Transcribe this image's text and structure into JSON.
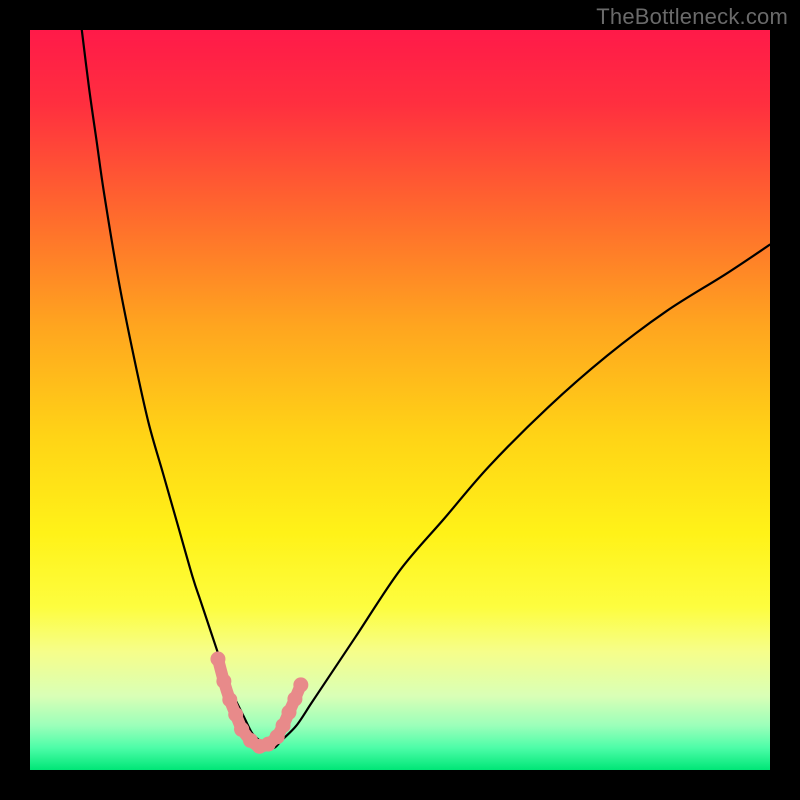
{
  "watermark": "TheBottleneck.com",
  "chart_data": {
    "type": "line",
    "title": "",
    "xlabel": "",
    "ylabel": "",
    "xlim": [
      0,
      100
    ],
    "ylim": [
      0,
      100
    ],
    "grid": false,
    "legend": false,
    "annotations": [],
    "background_gradient": {
      "type": "vertical",
      "stops": [
        {
          "offset": 0.0,
          "color": "#ff1a49"
        },
        {
          "offset": 0.1,
          "color": "#ff2f3f"
        },
        {
          "offset": 0.25,
          "color": "#ff6a2d"
        },
        {
          "offset": 0.4,
          "color": "#ffa51f"
        },
        {
          "offset": 0.55,
          "color": "#ffd416"
        },
        {
          "offset": 0.68,
          "color": "#fff218"
        },
        {
          "offset": 0.78,
          "color": "#fdfd3f"
        },
        {
          "offset": 0.84,
          "color": "#f6fe8a"
        },
        {
          "offset": 0.9,
          "color": "#d9ffb6"
        },
        {
          "offset": 0.94,
          "color": "#9bffba"
        },
        {
          "offset": 0.97,
          "color": "#4dfda8"
        },
        {
          "offset": 1.0,
          "color": "#00e677"
        }
      ]
    },
    "series": [
      {
        "name": "bottleneck-curve",
        "color": "#000000",
        "x": [
          7,
          8,
          9,
          10,
          12,
          14,
          16,
          18,
          20,
          22,
          23,
          24,
          25,
          26,
          27,
          28,
          29,
          30,
          31,
          32,
          33,
          34,
          36,
          38,
          40,
          44,
          50,
          56,
          62,
          70,
          78,
          86,
          94,
          100
        ],
        "y": [
          100,
          92,
          85,
          78,
          66,
          56,
          47,
          40,
          33,
          26,
          23,
          20,
          17,
          14,
          11,
          9,
          7,
          5,
          4,
          3,
          3,
          4,
          6,
          9,
          12,
          18,
          27,
          34,
          41,
          49,
          56,
          62,
          67,
          71
        ]
      }
    ],
    "overlay_segments": [
      {
        "name": "highlight-left",
        "color": "#e88a8a",
        "x": [
          25.4,
          26.2,
          27.0,
          27.8,
          28.6
        ],
        "y": [
          15.0,
          12.0,
          9.5,
          7.5,
          5.5
        ]
      },
      {
        "name": "highlight-bottom",
        "color": "#e88a8a",
        "x": [
          28.6,
          29.8,
          31.0,
          32.2,
          33.4
        ],
        "y": [
          5.5,
          4.0,
          3.2,
          3.5,
          4.5
        ]
      },
      {
        "name": "highlight-right",
        "color": "#e88a8a",
        "x": [
          33.4,
          34.2,
          35.0,
          35.8,
          36.6
        ],
        "y": [
          4.5,
          6.0,
          7.8,
          9.6,
          11.5
        ]
      }
    ]
  }
}
